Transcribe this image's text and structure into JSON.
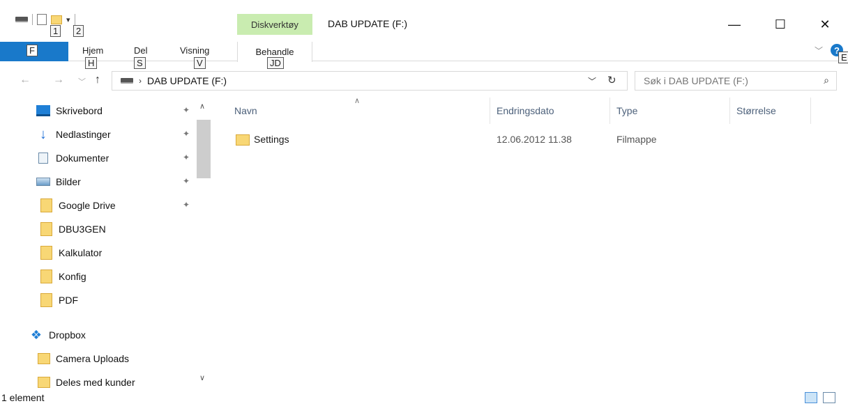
{
  "title": "DAB UPDATE (F:)",
  "tool_tab": "Diskverktøy",
  "qat_keytips": [
    "1",
    "2"
  ],
  "ribbon": {
    "file_keytip": "F",
    "tabs": [
      {
        "label": "Hjem",
        "keytip": "H"
      },
      {
        "label": "Del",
        "keytip": "S"
      },
      {
        "label": "Visning",
        "keytip": "V"
      }
    ],
    "active_tab": {
      "label": "Behandle",
      "keytip": "JD"
    },
    "help_keytip": "E"
  },
  "address": {
    "path": "DAB UPDATE (F:)",
    "search_placeholder": "Søk i DAB UPDATE (F:)"
  },
  "sidebar": {
    "items": [
      {
        "label": "Skrivebord",
        "icon": "desktop-icon",
        "pinned": true
      },
      {
        "label": "Nedlastinger",
        "icon": "download-icon",
        "pinned": true
      },
      {
        "label": "Dokumenter",
        "icon": "documents-icon",
        "pinned": true
      },
      {
        "label": "Bilder",
        "icon": "pictures-icon",
        "pinned": true
      },
      {
        "label": "Google Drive",
        "icon": "folder-icon",
        "pinned": true
      },
      {
        "label": "DBU3GEN",
        "icon": "folder-icon",
        "pinned": false
      },
      {
        "label": "Kalkulator",
        "icon": "folder-icon",
        "pinned": false
      },
      {
        "label": "Konfig",
        "icon": "folder-icon",
        "pinned": false
      },
      {
        "label": "PDF",
        "icon": "folder-icon",
        "pinned": false
      }
    ],
    "dropbox": {
      "label": "Dropbox",
      "icon": "dropbox-icon"
    },
    "dropbox_items": [
      {
        "label": "Camera Uploads",
        "icon": "camera-folder-icon"
      },
      {
        "label": "Deles med kunder",
        "icon": "shared-folder-icon"
      }
    ]
  },
  "columns": {
    "name": "Navn",
    "date": "Endringsdato",
    "type": "Type",
    "size": "Størrelse"
  },
  "rows": [
    {
      "name": "Settings",
      "date": "12.06.2012 11.38",
      "type": "Filmappe",
      "size": ""
    }
  ],
  "status": {
    "count": "1 element"
  },
  "colors": {
    "accent": "#1979ca",
    "tool_tab_bg": "#c9ecb0"
  }
}
